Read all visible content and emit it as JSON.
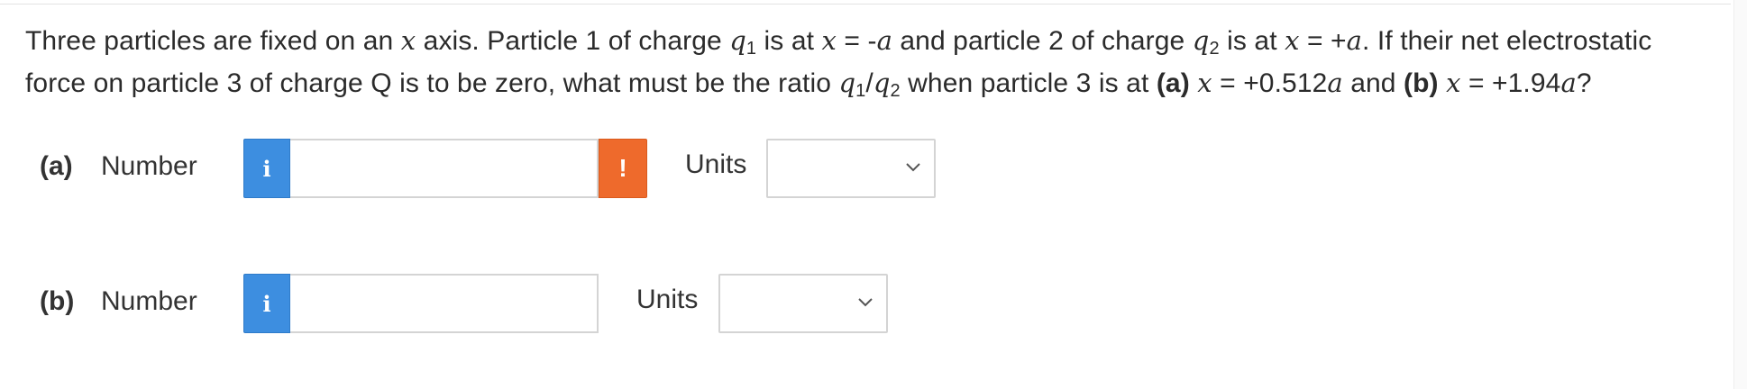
{
  "problem": {
    "t1": "Three particles are fixed on an ",
    "x1": "x",
    "t2": " axis. Particle 1 of charge ",
    "q1_var": "q",
    "q1_sub": "1",
    "t3": " is at ",
    "x2": "x",
    "t4": " = -",
    "a1": "a",
    "t5": " and particle 2 of charge ",
    "q2_var": "q",
    "q2_sub": "2",
    "t6": " is at ",
    "x3": "x",
    "t7": " = +",
    "a2": "a",
    "t8": ". If their net electrostatic force on particle 3 of charge Q is to be zero, what must be the ratio ",
    "r_q1_var": "q",
    "r_q1_sub": "1",
    "slash": "/",
    "r_q2_var": "q",
    "r_q2_sub": "2",
    "t9": " when particle 3 is at ",
    "part_a": "(a)",
    "t10": " ",
    "x4": "x",
    "t11": " = +0.512",
    "a3": "a",
    "t12": " and ",
    "part_b": "(b)",
    "t13": " ",
    "x5": "x",
    "t14": " = +1.94",
    "a4": "a",
    "t15": "?"
  },
  "answers": [
    {
      "part_label": "(a)",
      "number_label": "Number",
      "info_icon": "i",
      "value": "",
      "warning_icon": "!",
      "units_label": "Units",
      "units_selected": ""
    },
    {
      "part_label": "(b)",
      "number_label": "Number",
      "info_icon": "i",
      "value": "",
      "units_label": "Units",
      "units_selected": ""
    }
  ],
  "colors": {
    "info": "#3d8ee0",
    "warning": "#ee6a2c",
    "border": "#d4d4d4"
  }
}
